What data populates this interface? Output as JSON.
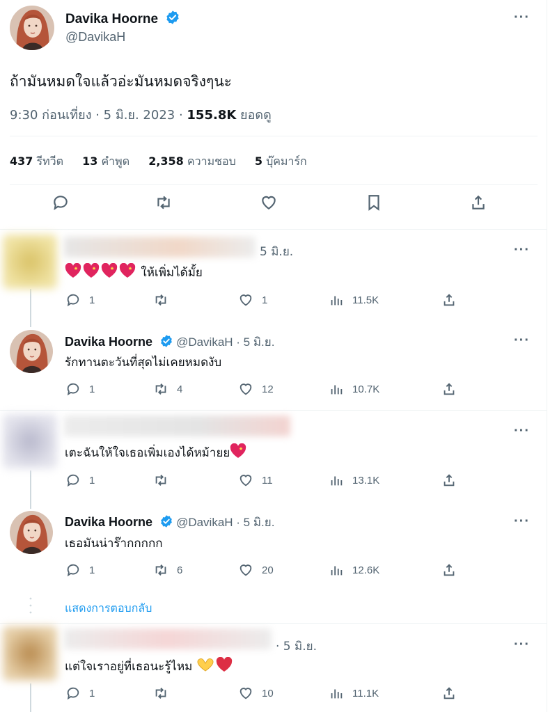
{
  "main_tweet": {
    "author_name": "Davika Hoorne",
    "author_handle": "@DavikaH",
    "text": "ถ้ามันหมดใจแล้วอ่ะมันหมดจริงๆนะ",
    "time": "9:30 ก่อนเที่ยง · 5 มิ.ย. 2023 · ",
    "views_count": "155.8K",
    "views_label": " ยอดดู",
    "stats": [
      {
        "count": "437",
        "label": "รีทวีต"
      },
      {
        "count": "13",
        "label": "คำพูด"
      },
      {
        "count": "2,358",
        "label": "ความชอบ"
      },
      {
        "count": "5",
        "label": "บุ๊คมาร์ก"
      }
    ],
    "more_label": "···"
  },
  "replies": [
    {
      "date": "5 มิ.ย.",
      "text": "ให้เพิ่มได้มั้ย",
      "reply_count": "1",
      "retweet_count": "",
      "like_count": "1",
      "views": "11.5K"
    },
    {
      "author_name": "Davika Hoorne",
      "author_handle": "@DavikaH · 5 มิ.ย.",
      "text": "รักทานตะวันที่สุดไม่เคยหมดงับ",
      "reply_count": "1",
      "retweet_count": "4",
      "like_count": "12",
      "views": "10.7K"
    },
    {
      "date": "",
      "text": "เตะฉันให้ใจเธอเพิ่มเองได้หม้ายย",
      "reply_count": "1",
      "retweet_count": "",
      "like_count": "11",
      "views": "13.1K"
    },
    {
      "author_name": "Davika Hoorne",
      "author_handle": "@DavikaH · 5 มิ.ย.",
      "text": "เธอมันน่าร๊ากกกกก",
      "reply_count": "1",
      "retweet_count": "6",
      "like_count": "20",
      "views": "12.6K"
    },
    {
      "date": "· 5 มิ.ย.",
      "text": "แต่ใจเราอยู่ที่เธอนะรู้ไหม",
      "reply_count": "1",
      "retweet_count": "",
      "like_count": "10",
      "views": "11.1K"
    }
  ],
  "show_replies_label": "แสดงการตอบกลับ",
  "colors": {
    "accent": "#1d9bf0",
    "text": "#0f1419",
    "muted": "#536471",
    "heart": "#e0245e"
  }
}
